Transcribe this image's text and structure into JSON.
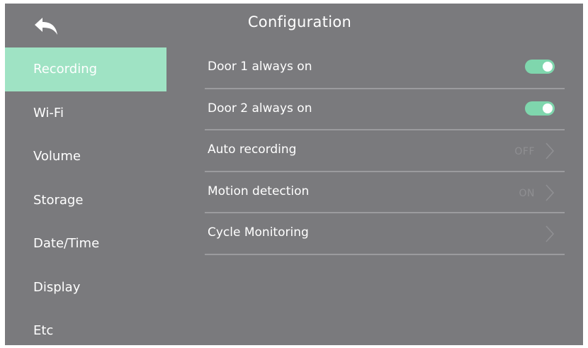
{
  "header": {
    "title": "Configuration",
    "back_icon": "back-arrow-icon"
  },
  "sidebar": {
    "items": [
      {
        "label": "Recording",
        "active": true
      },
      {
        "label": "Wi-Fi",
        "active": false
      },
      {
        "label": "Volume",
        "active": false
      },
      {
        "label": "Storage",
        "active": false
      },
      {
        "label": "Date/Time",
        "active": false
      },
      {
        "label": "Display",
        "active": false
      },
      {
        "label": "Etc",
        "active": false
      }
    ]
  },
  "settings": {
    "rows": [
      {
        "label": "Door 1 always on",
        "control": "toggle",
        "on": true
      },
      {
        "label": "Door 2 always on",
        "control": "toggle",
        "on": true
      },
      {
        "label": "Auto recording",
        "control": "value",
        "value": "OFF"
      },
      {
        "label": "Motion detection",
        "control": "value",
        "value": "ON"
      },
      {
        "label": "Cycle Monitoring",
        "control": "chevron",
        "value": ""
      }
    ]
  },
  "colors": {
    "background": "#7a7a7d",
    "active_item": "#9fe3c4",
    "toggle_on": "#7fd6ad",
    "divider": "#9b9b9e",
    "muted_text": "#8f8f92"
  }
}
